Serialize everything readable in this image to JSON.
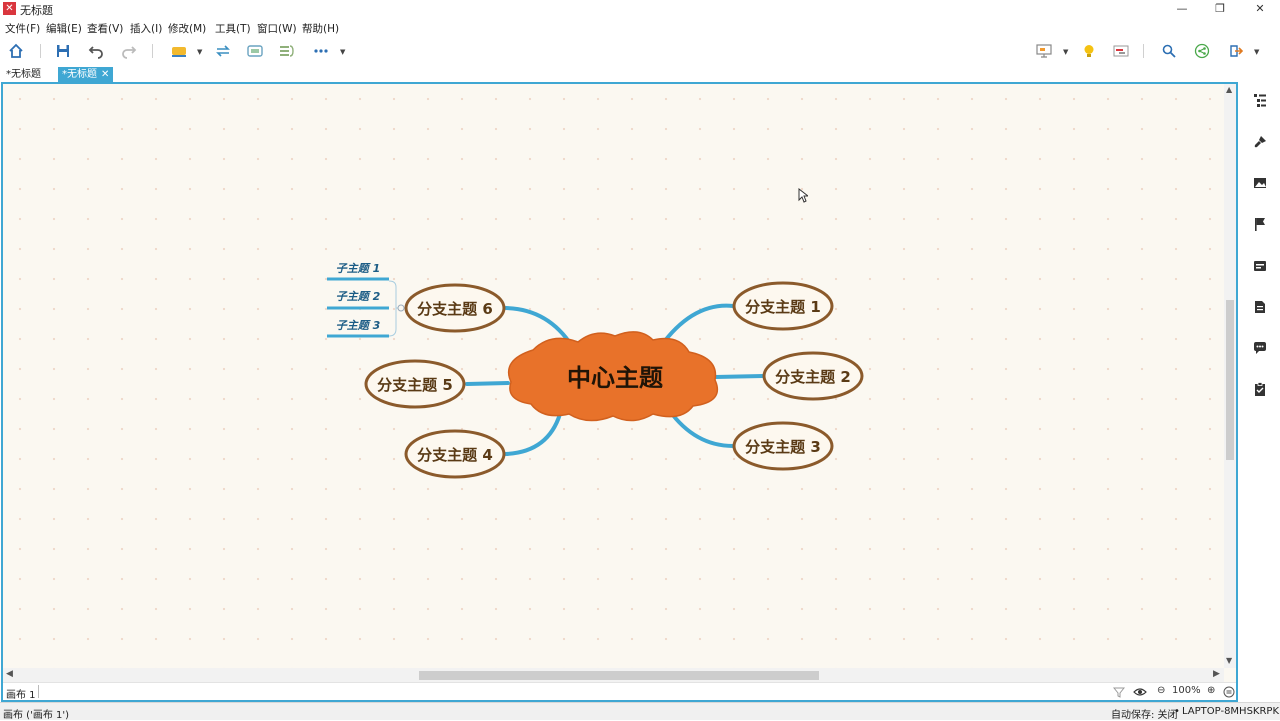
{
  "window": {
    "title": "无标题",
    "minimize": "—",
    "maximize": "❐",
    "close": "✕"
  },
  "menu": [
    "文件(F)",
    "编辑(E)",
    "查看(V)",
    "插入(I)",
    "修改(M)",
    "工具(T)",
    "窗口(W)",
    "帮助(H)"
  ],
  "tabs": [
    {
      "label": "*无标题",
      "active": false
    },
    {
      "label": "*无标题",
      "active": true,
      "close": "✕"
    }
  ],
  "mindmap": {
    "central": "中心主题",
    "branches": [
      "分支主题 1",
      "分支主题 2",
      "分支主题 3",
      "分支主题 4",
      "分支主题 5",
      "分支主题 6"
    ],
    "subtopics": [
      "子主题 1",
      "子主题 2",
      "子主题 3"
    ]
  },
  "sheet": {
    "label": "画布 1"
  },
  "zoom": {
    "level": "100%",
    "minus": "⊖",
    "plus": "⊕"
  },
  "status": {
    "left": "画布 ('画布 1')",
    "autosave": "自动保存: 关闭",
    "computer": "LAPTOP-8MHSKRPK"
  },
  "colors": {
    "accent": "#3fa7d3",
    "central_fill": "#e8722a",
    "branch_border": "#8b5a2b",
    "connector": "#3fa7d3",
    "canvas_bg": "#fbf8f1"
  }
}
